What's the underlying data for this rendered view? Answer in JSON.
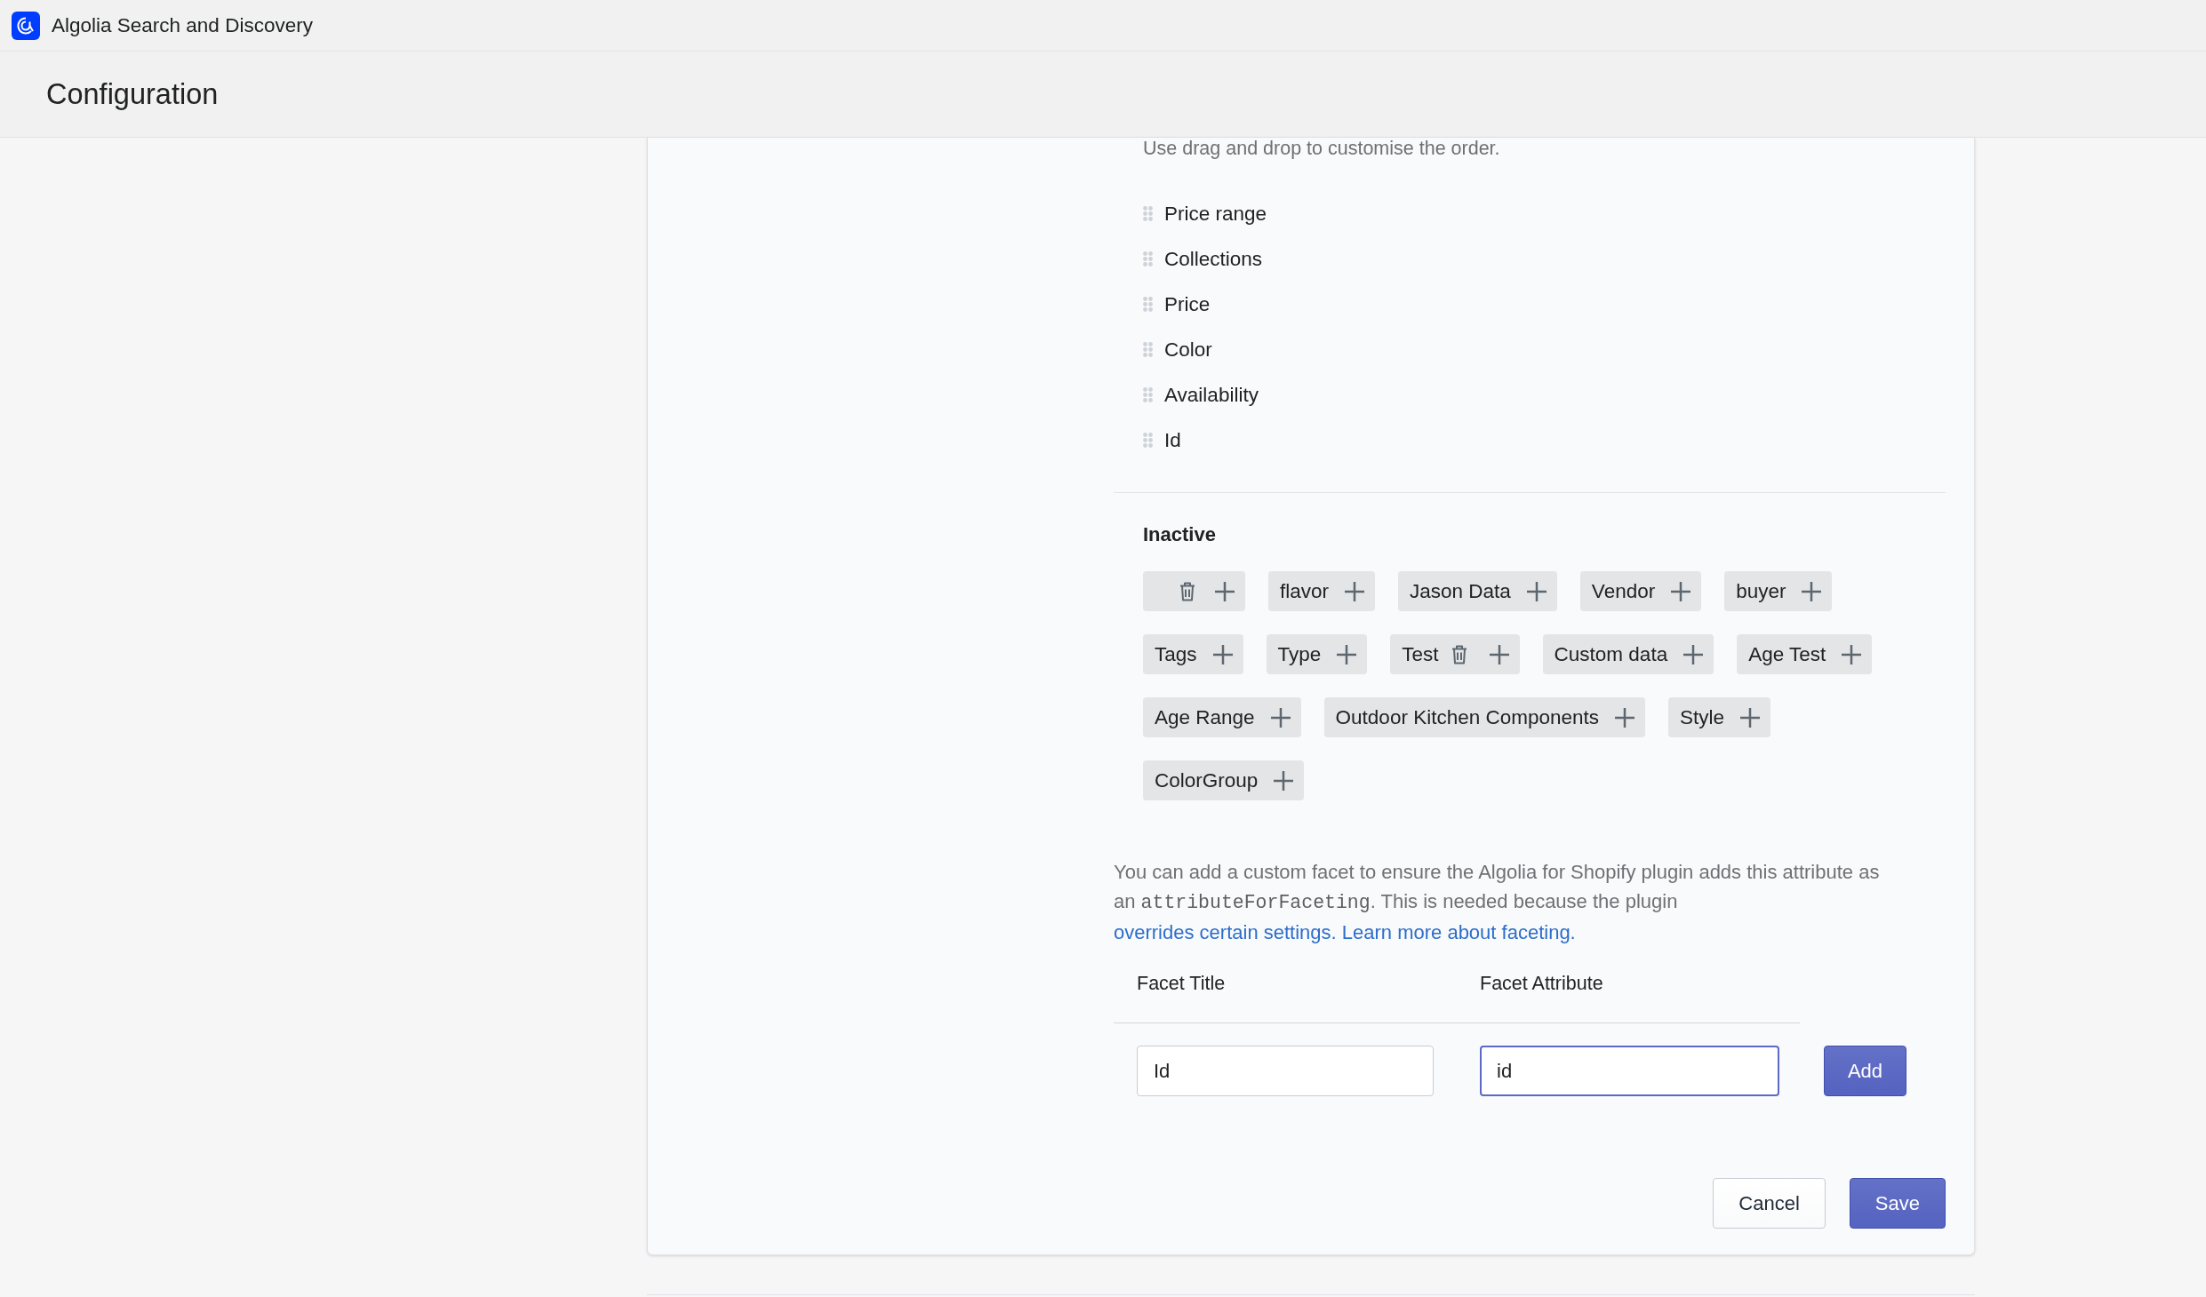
{
  "app_bar": {
    "title": "Algolia Search and Discovery"
  },
  "page_header": {
    "title": "Configuration"
  },
  "active_facets": {
    "hint": "Use drag and drop to customise the order.",
    "items": [
      "Price range",
      "Collections",
      "Price",
      "Color",
      "Availability",
      "Id"
    ]
  },
  "inactive_facets": {
    "title": "Inactive",
    "tags": [
      {
        "deletable": true
      },
      {
        "label": "flavor",
        "deletable": false
      },
      {
        "label": "Jason Data",
        "deletable": false
      },
      {
        "label": "Vendor",
        "deletable": false
      },
      {
        "label": "buyer",
        "deletable": false
      },
      {
        "label": "Tags",
        "deletable": false
      },
      {
        "label": "Type",
        "deletable": false
      },
      {
        "label": "Test",
        "deletable": true
      },
      {
        "label": "Custom data",
        "deletable": false
      },
      {
        "label": "Age Test",
        "deletable": false
      },
      {
        "label": "Age Range",
        "deletable": false
      },
      {
        "label": "Outdoor Kitchen Components",
        "deletable": false
      },
      {
        "label": "Style",
        "deletable": false
      },
      {
        "label": "ColorGroup",
        "deletable": false
      }
    ]
  },
  "custom_facet": {
    "description": {
      "text_before": "You can add a custom facet to ensure the Algolia for Shopify plugin adds this attribute as an ",
      "code": "attributeForFaceting",
      "text_after": ". This is needed because the plugin",
      "link": "overrides certain settings. Learn more about faceting."
    },
    "columns": [
      "Facet Title",
      "Facet Attribute"
    ],
    "fields": [
      {
        "value": "Id",
        "focused": false
      },
      {
        "value": "id",
        "focused": true
      }
    ],
    "add_button": "Add"
  },
  "footer_buttons": [
    {
      "label": "Cancel",
      "kind": "secondary"
    },
    {
      "label": "Save",
      "kind": "primary"
    }
  ]
}
